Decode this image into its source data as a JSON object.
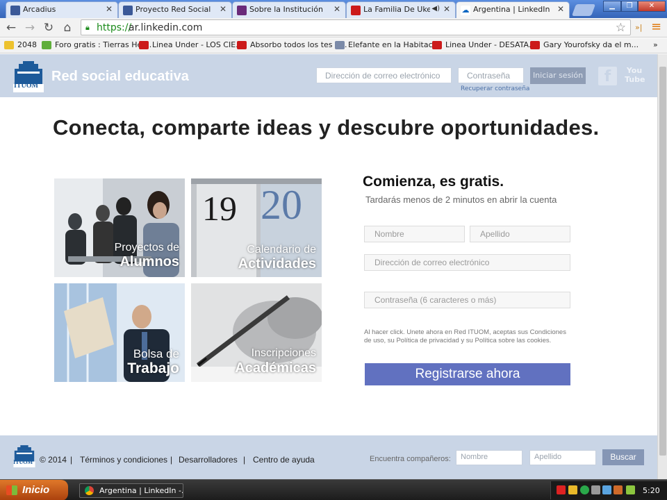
{
  "browser": {
    "tabs": [
      {
        "title": "Arcadius",
        "favicon": "facebook-icon",
        "active": false
      },
      {
        "title": "Proyecto Red Social",
        "favicon": "facebook-icon",
        "active": false
      },
      {
        "title": "Sobre la Institución",
        "favicon": "site-icon",
        "active": false
      },
      {
        "title": "La Familia De Ukelele",
        "favicon": "youtube-icon",
        "active": false
      },
      {
        "title": "Argentina | LinkedIn",
        "favicon": "linkedin-icon",
        "active": true
      }
    ],
    "url_scheme": "https://",
    "url_host": "ar.linkedin.com",
    "bookmarks": [
      {
        "label": "2048",
        "icon": "2048-icon"
      },
      {
        "label": "Foro gratis : Tierras Her...",
        "icon": "forum-icon"
      },
      {
        "label": "Linea Under - LOS CIE...",
        "icon": "youtube-icon"
      },
      {
        "label": "Absorbo todos los tes d...",
        "icon": "youtube-icon"
      },
      {
        "label": "Elefante en la Habitaci...",
        "icon": "site-icon"
      },
      {
        "label": "Linea Under - DESATA...",
        "icon": "youtube-icon"
      },
      {
        "label": "Gary Yourofsky da el m...",
        "icon": "youtube-icon"
      }
    ],
    "bookmarks_overflow": "»"
  },
  "site": {
    "brand": "ITUOM",
    "header_title": "Red social educativa",
    "email_placeholder": "Dirección de correo electrónico",
    "password_placeholder": "Contraseña",
    "login_label": "Iniciar sesión",
    "recover_label": "Recuperar contraseña",
    "youtube_icon_text": "You\nTube",
    "headline": "Conecta, comparte ideas y descubre oportunidades.",
    "tiles": [
      {
        "line1": "Proyectos de",
        "line2": "Alumnos"
      },
      {
        "line1": "Calendario de",
        "line2": "Actividades",
        "num1": "19",
        "num2": "20"
      },
      {
        "line1": "Bolsa de",
        "line2": "Trabajo"
      },
      {
        "line1": "Inscripciones",
        "line2": "Académicas"
      }
    ],
    "signup": {
      "title": "Comienza, es gratis.",
      "subtitle": "Tardarás menos de 2 minutos en abrir la cuenta",
      "first_name_placeholder": "Nombre",
      "last_name_placeholder": "Apellido",
      "email_placeholder": "Dirección de correo electrónico",
      "password_placeholder": "Contraseña (6 caracteres o más)",
      "terms": "Al hacer click. Unete ahora en Red ITUOM, aceptas sus Condiciones de uso, su Política de privacidad y su Política sobre las cookies.",
      "register_label": "Registrarse ahora"
    },
    "footer": {
      "copyright": "© 2014",
      "links": [
        "Términos y condiciones",
        "Desarrolladores",
        "Centro de ayuda"
      ],
      "separator": "|",
      "search_label": "Encuentra compañeros:",
      "first_name_placeholder": "Nombre",
      "last_name_placeholder": "Apellido",
      "search_label_btn": "Buscar"
    }
  },
  "taskbar": {
    "start_label": "Inicio",
    "task_label": "Argentina | LinkedIn -...",
    "clock": "5:20"
  }
}
